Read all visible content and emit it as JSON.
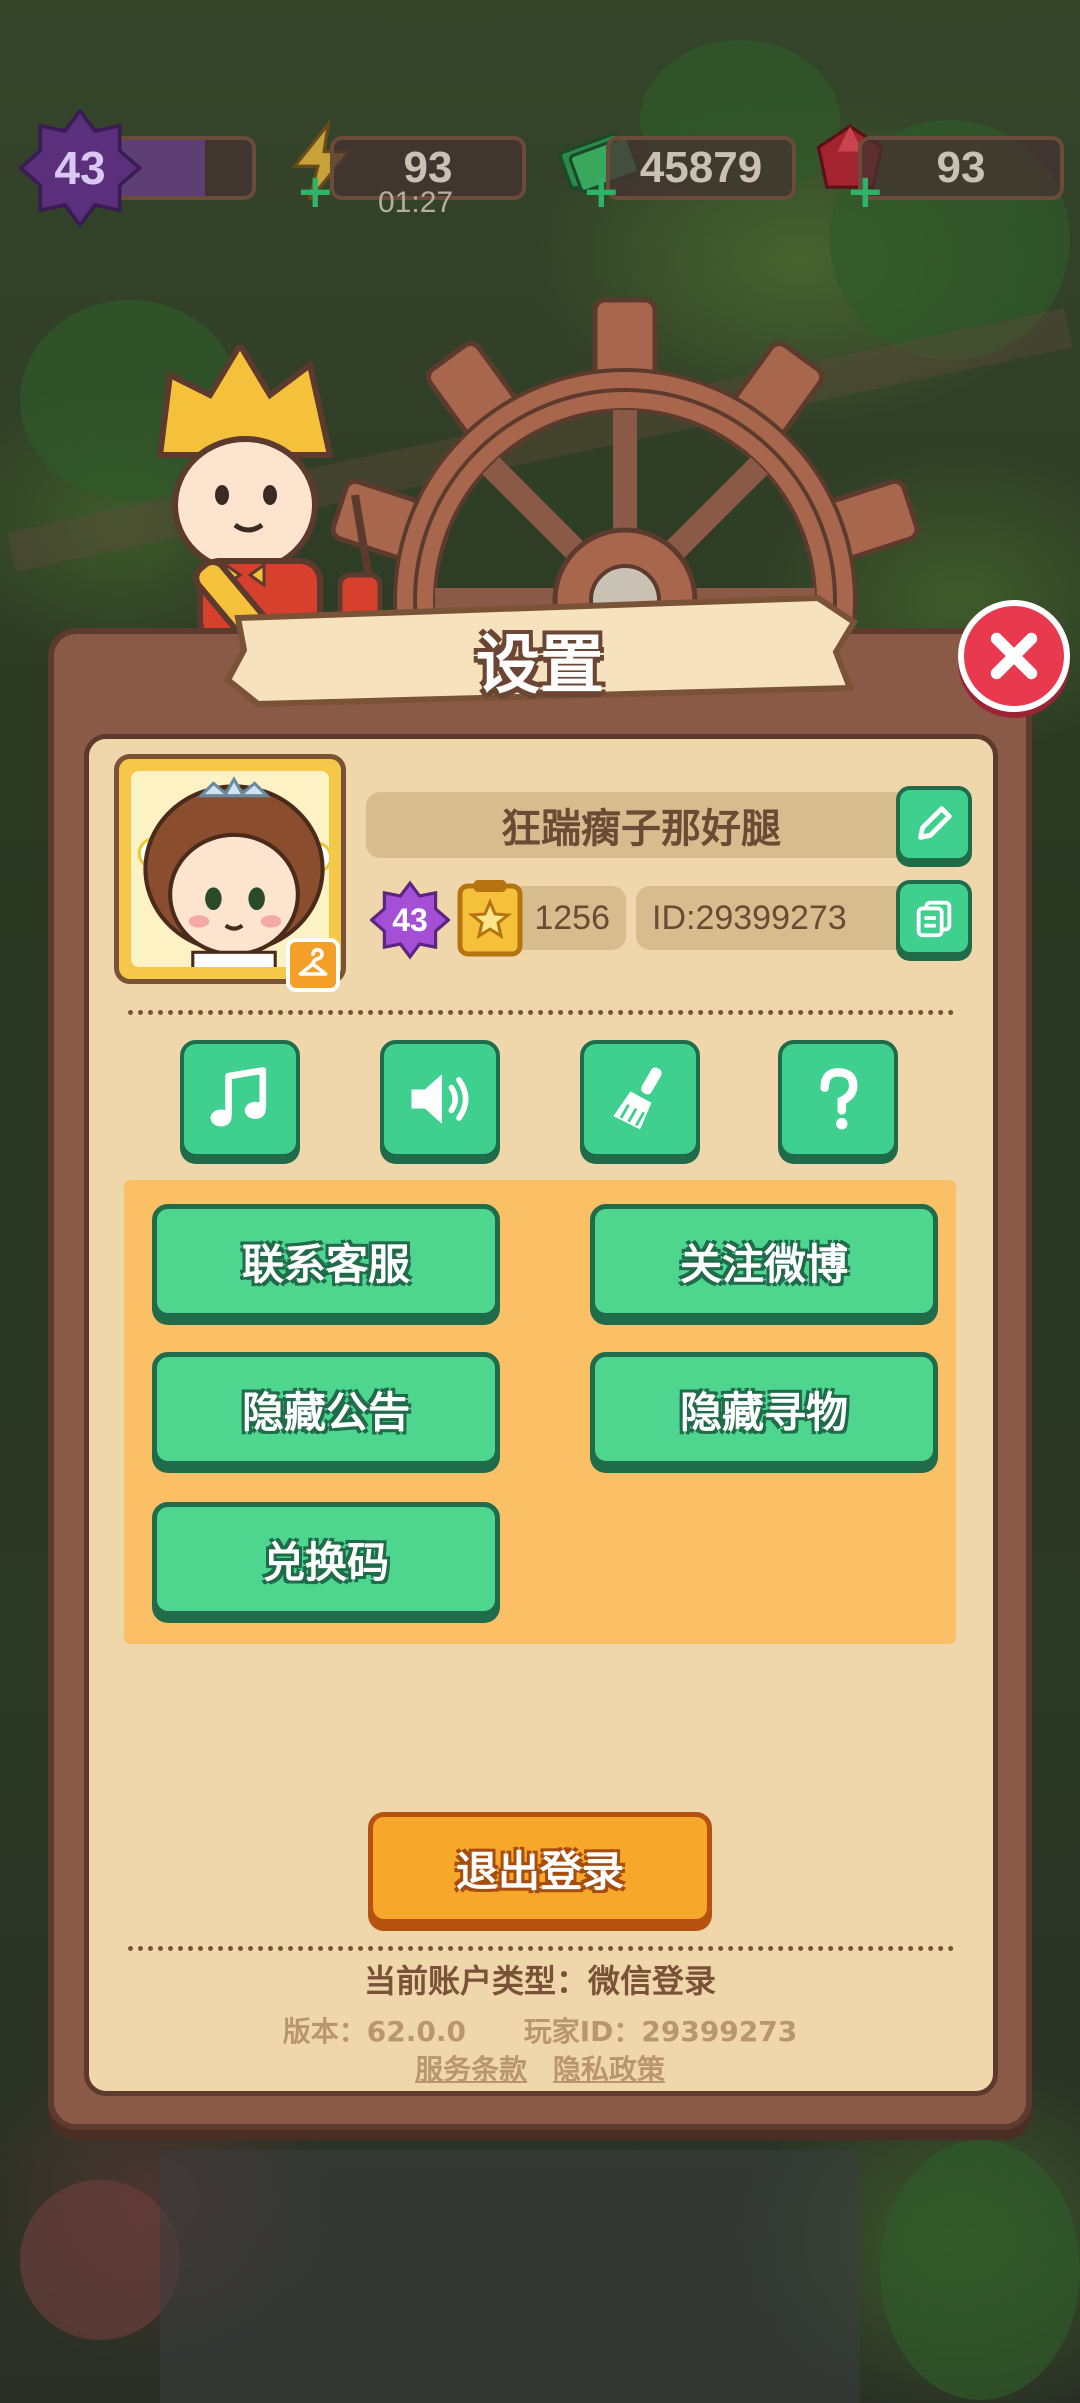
{
  "hud": {
    "level": "43",
    "energy": "93",
    "energy_timer": "01:27",
    "cash": "45879",
    "gems": "93"
  },
  "dialog": {
    "title": "设置"
  },
  "profile": {
    "name": "狂踹瘸子那好腿",
    "level": "43",
    "medals": "1256",
    "id_label": "ID:29399273"
  },
  "icon_buttons": [
    "music-icon",
    "speaker-icon",
    "broom-icon",
    "help-icon"
  ],
  "actions": {
    "contact_support": "联系客服",
    "follow_weibo": "关注微博",
    "hide_notice": "隐藏公告",
    "hide_search": "隐藏寻物",
    "redeem_code": "兑换码"
  },
  "logout": "退出登录",
  "footer": {
    "account_type": "当前账户类型：微信登录",
    "version": "版本：62.0.0",
    "player_id": "玩家ID：29399273",
    "terms": "服务条款",
    "privacy": "隐私政策"
  },
  "colors": {
    "panel_brown": "#8b5a47",
    "panel_cream": "#efd7ab",
    "button_green": "#4ed68e",
    "orange_area": "#fbbf66",
    "logout_orange": "#f7a72a",
    "close_red": "#e8394e"
  }
}
